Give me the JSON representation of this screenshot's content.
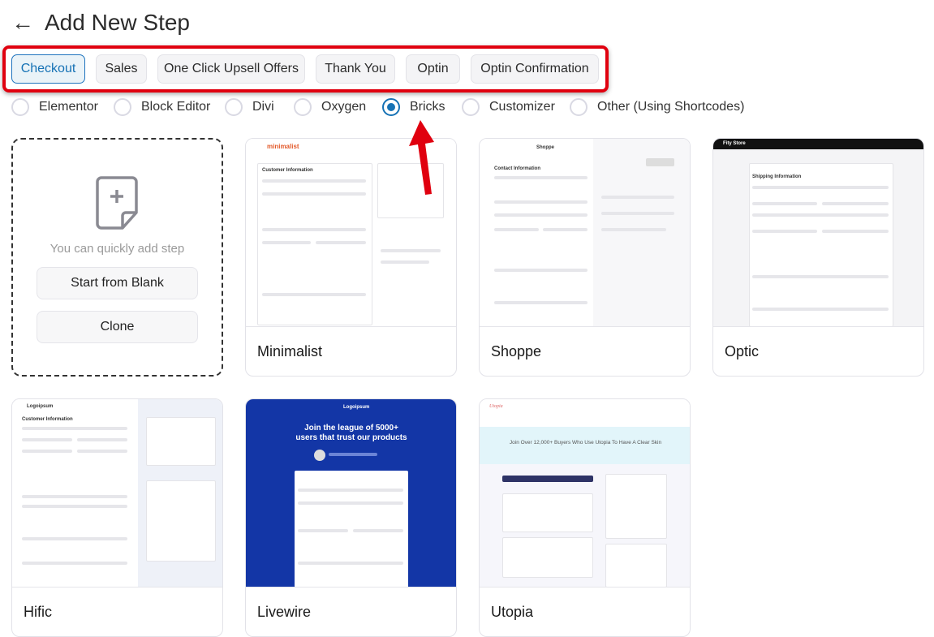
{
  "header": {
    "back_icon": "arrow-left-icon",
    "title": "Add New Step"
  },
  "tabs": [
    {
      "label": "Checkout",
      "active": true
    },
    {
      "label": "Sales",
      "active": false
    },
    {
      "label": "One Click Upsell Offers",
      "active": false
    },
    {
      "label": "Thank You",
      "active": false
    },
    {
      "label": "Optin",
      "active": false
    },
    {
      "label": "Optin Confirmation",
      "active": false
    }
  ],
  "builders": [
    {
      "label": "Elementor",
      "selected": false
    },
    {
      "label": "Block Editor",
      "selected": false
    },
    {
      "label": "Divi",
      "selected": false
    },
    {
      "label": "Oxygen",
      "selected": false
    },
    {
      "label": "Bricks",
      "selected": true
    },
    {
      "label": "Customizer",
      "selected": false
    },
    {
      "label": "Other (Using Shortcodes)",
      "selected": false
    }
  ],
  "blank_card": {
    "icon": "file-plus-icon",
    "hint": "You can quickly add step",
    "start_blank": "Start from Blank",
    "clone": "Clone"
  },
  "templates": [
    {
      "name": "Minimalist",
      "logo": "minimalist",
      "heading": "Customer Information"
    },
    {
      "name": "Shoppe",
      "logo": "Shoppe",
      "heading": "Contact Information"
    },
    {
      "name": "Optic",
      "logo": "Fity Store",
      "heading": "Shipping Information"
    },
    {
      "name": "Hific",
      "logo": "Logoipsum",
      "heading": "Customer Information"
    },
    {
      "name": "Livewire",
      "logo": "Logoipsum",
      "heading": "Join the league of 5000+ users that trust our products"
    },
    {
      "name": "Utopia",
      "logo": "Utopia",
      "heading": "Join Over 12,000+ Buyers Who Use Utopia To Have A Clear Skin"
    }
  ],
  "colors": {
    "accent": "#1672b5",
    "annotation": "#e0000f",
    "livewire_bg": "#1336a6",
    "utopia_banner": "#e2f5fa"
  }
}
